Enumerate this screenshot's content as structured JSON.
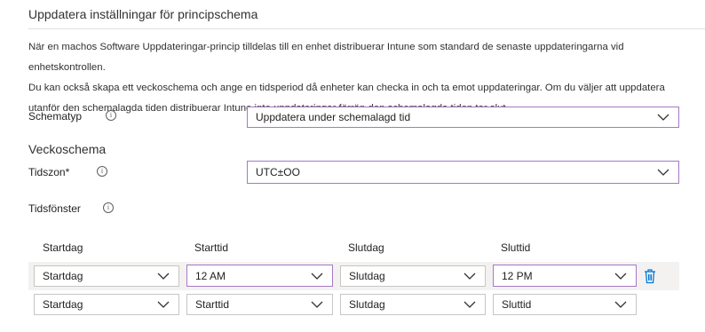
{
  "section_title": "Uppdatera inställningar för principschema",
  "description": [
    "När en machos Software Uppdateringar-princip tilldelas till en enhet distribuerar Intune som standard de senaste uppdateringarna vid enhetskontrollen.",
    "Du kan också skapa ett veckoschema och ange en tidsperiod då enheter kan checka in och ta emot uppdateringar. Om du väljer att uppdatera",
    "utanför den schemalagda tiden distribuerar Intune inte uppdateringar förrän den schemalagda tiden tar slut."
  ],
  "schedule_type": {
    "label": "Schematyp",
    "value": "Uppdatera under schemalagd tid"
  },
  "weekly_schedule_heading": "Veckoschema",
  "timezone": {
    "label": "Tidszon*",
    "value": "UTC±OO"
  },
  "time_window_label": "Tidsfönster",
  "table": {
    "headers": [
      "Startdag",
      "Starttid",
      "Slutdag",
      "Sluttid"
    ],
    "rows": [
      {
        "start_day": "Startdag",
        "start_time": "12 AM",
        "end_day": "Slutdag",
        "end_time": "12 PM"
      },
      {
        "start_day": "Startdag",
        "start_time": "Starttid",
        "end_day": "Slutdag",
        "end_time": "Sluttid"
      }
    ]
  },
  "icons": {
    "info": "info-icon",
    "chevron": "chevron-down-icon",
    "delete": "trash-icon"
  },
  "colors": {
    "accent_border": "#a678c6",
    "delete_icon": "#0078d4"
  }
}
